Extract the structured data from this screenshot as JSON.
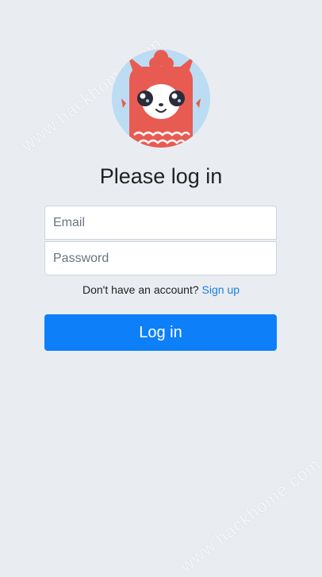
{
  "watermark": {
    "top_text": "www.hackhome.com",
    "bottom_text": "www.hackhome.com"
  },
  "avatar": {
    "icon": "llama-mascot-icon",
    "bg_color": "#bcdcf3",
    "body_color": "#e85b52"
  },
  "form": {
    "title": "Please log in",
    "email_placeholder": "Email",
    "password_placeholder": "Password",
    "signup_prompt": "Don't have an account?",
    "signup_link": "Sign up",
    "submit_label": "Log in",
    "button_color": "#0d7ff9",
    "link_color": "#1a7fe0"
  }
}
